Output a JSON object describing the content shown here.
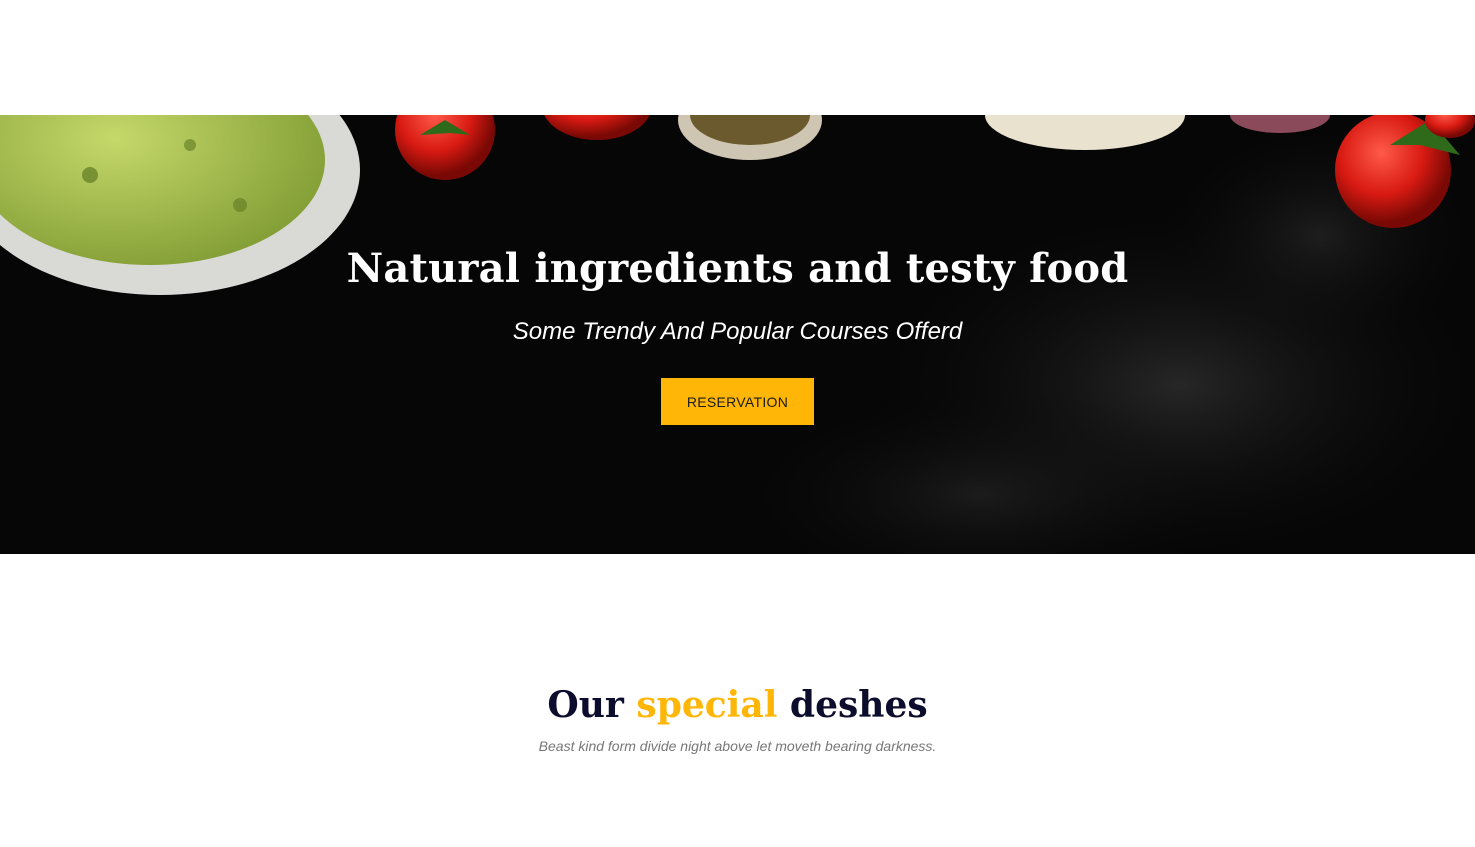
{
  "hero": {
    "title": "Natural ingredients and testy food",
    "subtitle": "Some Trendy And Popular Courses Offerd",
    "button_label": "RESERVATION",
    "background": "dark slate with guacamole bowl, tomatoes, spices"
  },
  "special": {
    "title_part1": "Our",
    "title_accent": "special",
    "title_part2": "deshes",
    "description": "Beast kind form divide night above let moveth bearing darkness."
  },
  "colors": {
    "accent": "#ffb606",
    "heading_dark": "#0c0c2c",
    "hero_bg": "#050505",
    "muted_text": "#777777"
  }
}
